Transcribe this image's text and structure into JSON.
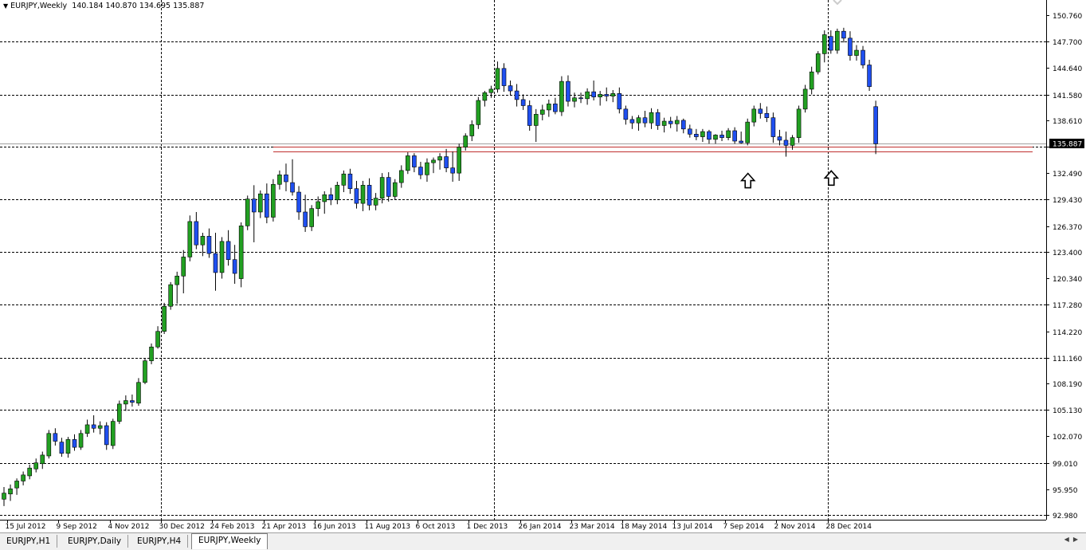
{
  "header": {
    "symbol": "EURJPY,Weekly",
    "ohlc": "140.184 140.870 134.695 135.887"
  },
  "tabs": [
    {
      "label": "EURJPY,H1",
      "active": false
    },
    {
      "label": "EURJPY,Daily",
      "active": false
    },
    {
      "label": "EURJPY,H4",
      "active": false
    },
    {
      "label": "EURJPY,Weekly",
      "active": true
    }
  ],
  "tab_nav": {
    "left_icon": "triangle-left-icon",
    "right_icon": "triangle-right-icon"
  },
  "current_price_label": "135.887",
  "colors": {
    "bull": "#22a022",
    "bear": "#1f4ff0",
    "grid": "#000000",
    "support": "#c0302e",
    "price_line": "#a0a0a0",
    "background": "#ffffff"
  },
  "chart_data": {
    "type": "candlestick",
    "title": "EURJPY,Weekly",
    "ylim": [
      92.98,
      150.76
    ],
    "y_ticks": [
      "150.760",
      "147.700",
      "144.640",
      "141.580",
      "138.610",
      "135.550",
      "132.490",
      "129.430",
      "126.370",
      "123.400",
      "120.340",
      "117.280",
      "114.220",
      "111.160",
      "108.190",
      "105.130",
      "102.070",
      "99.010",
      "95.950",
      "92.980"
    ],
    "x_ticks": [
      "15 Jul 2012",
      "9 Sep 2012",
      "4 Nov 2012",
      "30 Dec 2012",
      "24 Feb 2013",
      "21 Apr 2013",
      "16 Jun 2013",
      "11 Aug 2013",
      "6 Oct 2013",
      "1 Dec 2013",
      "26 Jan 2014",
      "23 Mar 2014",
      "18 May 2014",
      "13 Jul 2014",
      "7 Sep 2014",
      "2 Nov 2014",
      "28 Dec 2014"
    ],
    "grid": true,
    "support_zone": [
      134.98,
      135.6
    ],
    "current_price": 135.887,
    "annotations": [
      "up-arrow at 7 Sep 2014 low",
      "up-arrow at 28 Dec 2014 low"
    ],
    "candles": [
      {
        "o": 94.8,
        "h": 96.2,
        "l": 94.0,
        "c": 95.5
      },
      {
        "o": 95.4,
        "h": 96.5,
        "l": 94.6,
        "c": 96.0
      },
      {
        "o": 96.1,
        "h": 97.2,
        "l": 95.3,
        "c": 96.9
      },
      {
        "o": 96.9,
        "h": 98.0,
        "l": 96.4,
        "c": 97.6
      },
      {
        "o": 97.5,
        "h": 98.8,
        "l": 97.1,
        "c": 98.4
      },
      {
        "o": 98.3,
        "h": 99.5,
        "l": 97.9,
        "c": 99.0
      },
      {
        "o": 98.9,
        "h": 100.3,
        "l": 98.3,
        "c": 99.9
      },
      {
        "o": 99.8,
        "h": 102.8,
        "l": 99.5,
        "c": 102.4
      },
      {
        "o": 102.4,
        "h": 103.0,
        "l": 101.0,
        "c": 101.5
      },
      {
        "o": 101.4,
        "h": 101.9,
        "l": 99.7,
        "c": 100.1
      },
      {
        "o": 100.1,
        "h": 102.0,
        "l": 99.6,
        "c": 101.7
      },
      {
        "o": 101.7,
        "h": 102.3,
        "l": 100.4,
        "c": 100.8
      },
      {
        "o": 100.8,
        "h": 102.8,
        "l": 100.5,
        "c": 102.4
      },
      {
        "o": 102.4,
        "h": 104.0,
        "l": 102.0,
        "c": 103.4
      },
      {
        "o": 103.4,
        "h": 104.5,
        "l": 102.5,
        "c": 103.0
      },
      {
        "o": 103.0,
        "h": 103.8,
        "l": 102.3,
        "c": 103.3
      },
      {
        "o": 103.3,
        "h": 103.7,
        "l": 100.5,
        "c": 101.1
      },
      {
        "o": 101.0,
        "h": 104.1,
        "l": 100.6,
        "c": 103.8
      },
      {
        "o": 103.8,
        "h": 106.2,
        "l": 103.5,
        "c": 105.8
      },
      {
        "o": 105.8,
        "h": 106.8,
        "l": 105.0,
        "c": 106.2
      },
      {
        "o": 106.2,
        "h": 106.9,
        "l": 105.5,
        "c": 106.0
      },
      {
        "o": 105.9,
        "h": 108.8,
        "l": 105.6,
        "c": 108.3
      },
      {
        "o": 108.3,
        "h": 111.1,
        "l": 108.1,
        "c": 110.8
      },
      {
        "o": 110.8,
        "h": 112.8,
        "l": 110.4,
        "c": 112.4
      },
      {
        "o": 112.4,
        "h": 114.8,
        "l": 112.2,
        "c": 114.2
      },
      {
        "o": 114.2,
        "h": 117.5,
        "l": 113.9,
        "c": 117.1
      },
      {
        "o": 117.1,
        "h": 119.9,
        "l": 116.7,
        "c": 119.6
      },
      {
        "o": 119.6,
        "h": 121.1,
        "l": 117.4,
        "c": 120.6
      },
      {
        "o": 120.6,
        "h": 123.6,
        "l": 118.6,
        "c": 122.8
      },
      {
        "o": 122.8,
        "h": 127.6,
        "l": 122.3,
        "c": 126.9
      },
      {
        "o": 126.9,
        "h": 128.0,
        "l": 123.7,
        "c": 124.2
      },
      {
        "o": 124.2,
        "h": 125.6,
        "l": 122.9,
        "c": 125.2
      },
      {
        "o": 125.2,
        "h": 126.1,
        "l": 122.7,
        "c": 123.2
      },
      {
        "o": 123.2,
        "h": 125.6,
        "l": 118.9,
        "c": 121.0
      },
      {
        "o": 121.0,
        "h": 125.1,
        "l": 120.3,
        "c": 124.6
      },
      {
        "o": 124.6,
        "h": 125.9,
        "l": 121.8,
        "c": 122.5
      },
      {
        "o": 122.5,
        "h": 124.2,
        "l": 119.7,
        "c": 120.9
      },
      {
        "o": 120.3,
        "h": 126.8,
        "l": 119.3,
        "c": 126.4
      },
      {
        "o": 126.4,
        "h": 129.9,
        "l": 125.9,
        "c": 129.5
      },
      {
        "o": 129.5,
        "h": 131.1,
        "l": 124.5,
        "c": 128.0
      },
      {
        "o": 128.0,
        "h": 130.5,
        "l": 127.3,
        "c": 130.1
      },
      {
        "o": 130.1,
        "h": 131.3,
        "l": 126.7,
        "c": 127.4
      },
      {
        "o": 127.4,
        "h": 131.8,
        "l": 126.9,
        "c": 131.2
      },
      {
        "o": 131.2,
        "h": 132.8,
        "l": 130.6,
        "c": 132.3
      },
      {
        "o": 132.3,
        "h": 133.6,
        "l": 130.4,
        "c": 131.5
      },
      {
        "o": 131.4,
        "h": 134.1,
        "l": 129.9,
        "c": 130.3
      },
      {
        "o": 130.3,
        "h": 131.0,
        "l": 127.1,
        "c": 128.0
      },
      {
        "o": 128.0,
        "h": 130.0,
        "l": 125.7,
        "c": 126.3
      },
      {
        "o": 126.3,
        "h": 128.8,
        "l": 125.8,
        "c": 128.4
      },
      {
        "o": 128.4,
        "h": 129.8,
        "l": 127.5,
        "c": 129.2
      },
      {
        "o": 129.2,
        "h": 130.4,
        "l": 127.8,
        "c": 130.0
      },
      {
        "o": 130.0,
        "h": 130.8,
        "l": 128.8,
        "c": 129.4
      },
      {
        "o": 129.4,
        "h": 131.5,
        "l": 128.9,
        "c": 131.1
      },
      {
        "o": 131.1,
        "h": 132.8,
        "l": 130.3,
        "c": 132.4
      },
      {
        "o": 132.4,
        "h": 133.0,
        "l": 130.1,
        "c": 130.7
      },
      {
        "o": 130.7,
        "h": 131.6,
        "l": 128.4,
        "c": 129.0
      },
      {
        "o": 129.0,
        "h": 131.6,
        "l": 128.1,
        "c": 131.1
      },
      {
        "o": 131.1,
        "h": 131.9,
        "l": 128.2,
        "c": 128.8
      },
      {
        "o": 128.8,
        "h": 130.2,
        "l": 128.2,
        "c": 129.6
      },
      {
        "o": 129.6,
        "h": 132.5,
        "l": 129.0,
        "c": 132.0
      },
      {
        "o": 132.0,
        "h": 132.6,
        "l": 129.2,
        "c": 129.8
      },
      {
        "o": 129.8,
        "h": 131.8,
        "l": 129.4,
        "c": 131.4
      },
      {
        "o": 131.4,
        "h": 133.4,
        "l": 130.8,
        "c": 132.8
      },
      {
        "o": 132.8,
        "h": 134.9,
        "l": 132.4,
        "c": 134.5
      },
      {
        "o": 134.5,
        "h": 134.8,
        "l": 132.6,
        "c": 133.2
      },
      {
        "o": 133.2,
        "h": 133.8,
        "l": 131.8,
        "c": 132.3
      },
      {
        "o": 132.3,
        "h": 134.2,
        "l": 131.5,
        "c": 133.7
      },
      {
        "o": 133.7,
        "h": 134.3,
        "l": 132.5,
        "c": 134.0
      },
      {
        "o": 134.0,
        "h": 134.8,
        "l": 132.9,
        "c": 134.4
      },
      {
        "o": 134.4,
        "h": 135.3,
        "l": 132.6,
        "c": 133.1
      },
      {
        "o": 133.1,
        "h": 135.0,
        "l": 131.5,
        "c": 132.5
      },
      {
        "o": 132.5,
        "h": 135.9,
        "l": 131.6,
        "c": 135.5
      },
      {
        "o": 135.5,
        "h": 137.1,
        "l": 135.1,
        "c": 136.8
      },
      {
        "o": 136.8,
        "h": 138.6,
        "l": 136.2,
        "c": 138.1
      },
      {
        "o": 138.1,
        "h": 141.3,
        "l": 137.6,
        "c": 140.9
      },
      {
        "o": 140.9,
        "h": 142.0,
        "l": 140.2,
        "c": 141.8
      },
      {
        "o": 141.8,
        "h": 142.6,
        "l": 141.2,
        "c": 142.2
      },
      {
        "o": 142.2,
        "h": 145.4,
        "l": 141.8,
        "c": 144.6
      },
      {
        "o": 144.6,
        "h": 145.2,
        "l": 141.9,
        "c": 142.6
      },
      {
        "o": 142.6,
        "h": 143.2,
        "l": 141.5,
        "c": 142.0
      },
      {
        "o": 142.0,
        "h": 142.8,
        "l": 140.2,
        "c": 141.0
      },
      {
        "o": 141.0,
        "h": 141.6,
        "l": 139.8,
        "c": 140.3
      },
      {
        "o": 140.3,
        "h": 140.9,
        "l": 137.4,
        "c": 138.0
      },
      {
        "o": 138.0,
        "h": 139.9,
        "l": 136.1,
        "c": 139.3
      },
      {
        "o": 139.3,
        "h": 140.4,
        "l": 138.6,
        "c": 139.8
      },
      {
        "o": 139.8,
        "h": 141.0,
        "l": 139.0,
        "c": 140.5
      },
      {
        "o": 140.5,
        "h": 141.2,
        "l": 139.3,
        "c": 139.6
      },
      {
        "o": 139.6,
        "h": 143.7,
        "l": 139.1,
        "c": 143.1
      },
      {
        "o": 143.1,
        "h": 143.8,
        "l": 140.2,
        "c": 140.8
      },
      {
        "o": 140.8,
        "h": 141.8,
        "l": 140.1,
        "c": 141.2
      },
      {
        "o": 141.2,
        "h": 141.8,
        "l": 140.6,
        "c": 141.1
      },
      {
        "o": 141.1,
        "h": 142.3,
        "l": 140.4,
        "c": 141.9
      },
      {
        "o": 141.9,
        "h": 143.2,
        "l": 140.9,
        "c": 141.3
      },
      {
        "o": 141.3,
        "h": 142.0,
        "l": 140.3,
        "c": 141.6
      },
      {
        "o": 141.6,
        "h": 142.4,
        "l": 140.8,
        "c": 141.4
      },
      {
        "o": 141.4,
        "h": 142.1,
        "l": 140.7,
        "c": 141.7
      },
      {
        "o": 141.7,
        "h": 142.4,
        "l": 139.4,
        "c": 139.9
      },
      {
        "o": 139.9,
        "h": 140.3,
        "l": 138.1,
        "c": 138.7
      },
      {
        "o": 138.7,
        "h": 139.1,
        "l": 137.6,
        "c": 138.3
      },
      {
        "o": 138.3,
        "h": 139.2,
        "l": 137.4,
        "c": 138.9
      },
      {
        "o": 138.9,
        "h": 139.7,
        "l": 137.8,
        "c": 138.3
      },
      {
        "o": 138.3,
        "h": 140.0,
        "l": 137.6,
        "c": 139.5
      },
      {
        "o": 139.5,
        "h": 139.9,
        "l": 137.5,
        "c": 138.0
      },
      {
        "o": 138.0,
        "h": 138.9,
        "l": 137.2,
        "c": 138.5
      },
      {
        "o": 138.5,
        "h": 139.0,
        "l": 137.7,
        "c": 138.2
      },
      {
        "o": 138.2,
        "h": 139.1,
        "l": 137.3,
        "c": 138.6
      },
      {
        "o": 138.6,
        "h": 138.8,
        "l": 137.1,
        "c": 137.6
      },
      {
        "o": 137.6,
        "h": 138.1,
        "l": 136.6,
        "c": 137.0
      },
      {
        "o": 137.0,
        "h": 137.6,
        "l": 136.3,
        "c": 136.7
      },
      {
        "o": 136.7,
        "h": 137.6,
        "l": 136.1,
        "c": 137.3
      },
      {
        "o": 137.3,
        "h": 137.5,
        "l": 135.9,
        "c": 136.4
      },
      {
        "o": 136.4,
        "h": 137.0,
        "l": 135.9,
        "c": 136.9
      },
      {
        "o": 136.9,
        "h": 137.4,
        "l": 136.2,
        "c": 136.6
      },
      {
        "o": 136.6,
        "h": 137.7,
        "l": 136.3,
        "c": 137.4
      },
      {
        "o": 137.4,
        "h": 137.8,
        "l": 135.9,
        "c": 136.2
      },
      {
        "o": 136.2,
        "h": 137.3,
        "l": 135.9,
        "c": 136.0
      },
      {
        "o": 136.0,
        "h": 138.8,
        "l": 135.7,
        "c": 138.4
      },
      {
        "o": 138.4,
        "h": 140.3,
        "l": 137.9,
        "c": 139.9
      },
      {
        "o": 139.9,
        "h": 140.6,
        "l": 138.8,
        "c": 139.4
      },
      {
        "o": 139.4,
        "h": 140.2,
        "l": 138.4,
        "c": 138.9
      },
      {
        "o": 138.9,
        "h": 139.5,
        "l": 136.0,
        "c": 136.7
      },
      {
        "o": 136.7,
        "h": 137.5,
        "l": 135.7,
        "c": 136.3
      },
      {
        "o": 136.3,
        "h": 137.3,
        "l": 134.4,
        "c": 135.7
      },
      {
        "o": 135.7,
        "h": 136.9,
        "l": 135.2,
        "c": 136.6
      },
      {
        "o": 136.6,
        "h": 140.3,
        "l": 136.0,
        "c": 139.9
      },
      {
        "o": 139.9,
        "h": 142.7,
        "l": 139.5,
        "c": 142.2
      },
      {
        "o": 142.2,
        "h": 144.8,
        "l": 141.6,
        "c": 144.2
      },
      {
        "o": 144.2,
        "h": 146.6,
        "l": 143.9,
        "c": 146.3
      },
      {
        "o": 146.3,
        "h": 149.0,
        "l": 145.3,
        "c": 148.5
      },
      {
        "o": 148.3,
        "h": 149.0,
        "l": 146.3,
        "c": 146.7
      },
      {
        "o": 146.7,
        "h": 149.2,
        "l": 146.3,
        "c": 148.9
      },
      {
        "o": 148.9,
        "h": 149.3,
        "l": 147.6,
        "c": 148.1
      },
      {
        "o": 148.1,
        "h": 148.9,
        "l": 145.5,
        "c": 146.1
      },
      {
        "o": 146.1,
        "h": 147.3,
        "l": 145.5,
        "c": 146.7
      },
      {
        "o": 146.7,
        "h": 147.2,
        "l": 144.6,
        "c": 145.0
      },
      {
        "o": 145.0,
        "h": 145.6,
        "l": 142.0,
        "c": 142.5
      },
      {
        "o": 140.184,
        "h": 140.87,
        "l": 134.695,
        "c": 135.887
      }
    ]
  }
}
